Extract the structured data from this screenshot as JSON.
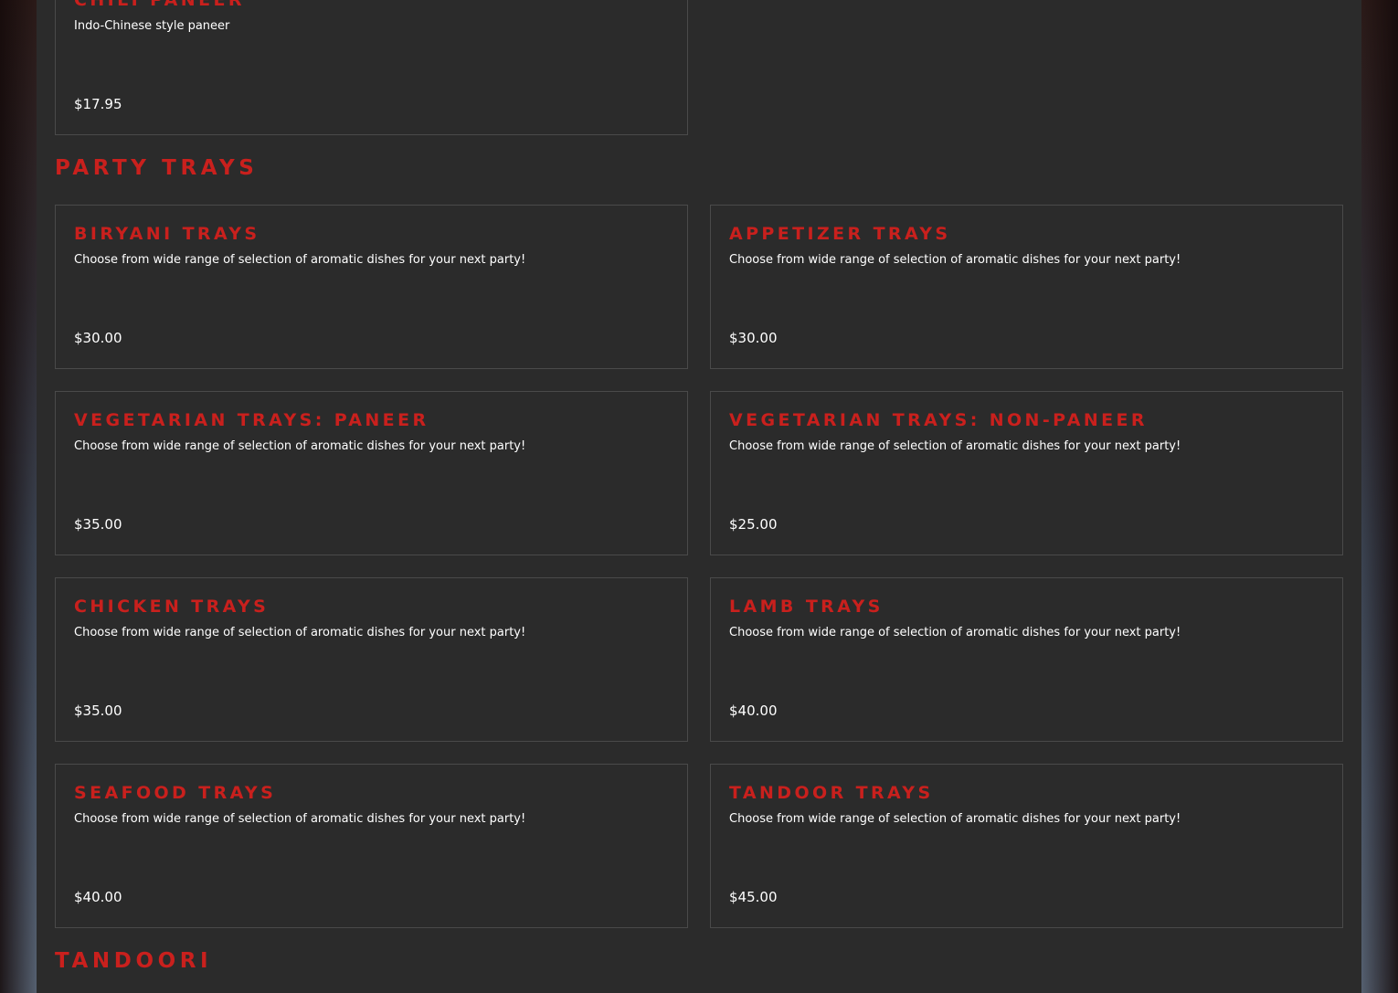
{
  "top_item": {
    "title": "Chili Paneer",
    "description": "Indo-Chinese style paneer",
    "price": "$17.95"
  },
  "party_trays": {
    "heading": "Party Trays",
    "items": [
      {
        "title": "Biryani Trays",
        "description": "Choose from wide range of selection of aromatic dishes for your next party!",
        "price": "$30.00"
      },
      {
        "title": "Appetizer Trays",
        "description": "Choose from wide range of selection of aromatic dishes for your next party!",
        "price": "$30.00"
      },
      {
        "title": "Vegetarian Trays: Paneer",
        "description": "Choose from wide range of selection of aromatic dishes for your next party!",
        "price": "$35.00"
      },
      {
        "title": "Vegetarian Trays: Non-Paneer",
        "description": "Choose from wide range of selection of aromatic dishes for your next party!",
        "price": "$25.00"
      },
      {
        "title": "Chicken Trays",
        "description": "Choose from wide range of selection of aromatic dishes for your next party!",
        "price": "$35.00"
      },
      {
        "title": "Lamb Trays",
        "description": "Choose from wide range of selection of aromatic dishes for your next party!",
        "price": "$40.00"
      },
      {
        "title": "Seafood Trays",
        "description": "Choose from wide range of selection of aromatic dishes for your next party!",
        "price": "$40.00"
      },
      {
        "title": "Tandoor Trays",
        "description": "Choose from wide range of selection of aromatic dishes for your next party!",
        "price": "$45.00"
      }
    ]
  },
  "tandoori": {
    "heading": "Tandoori"
  },
  "colors": {
    "accent": "#c9201d",
    "card_background": "#2b2b2b",
    "card_border": "#4a4a4a",
    "text": "#ffffff"
  }
}
